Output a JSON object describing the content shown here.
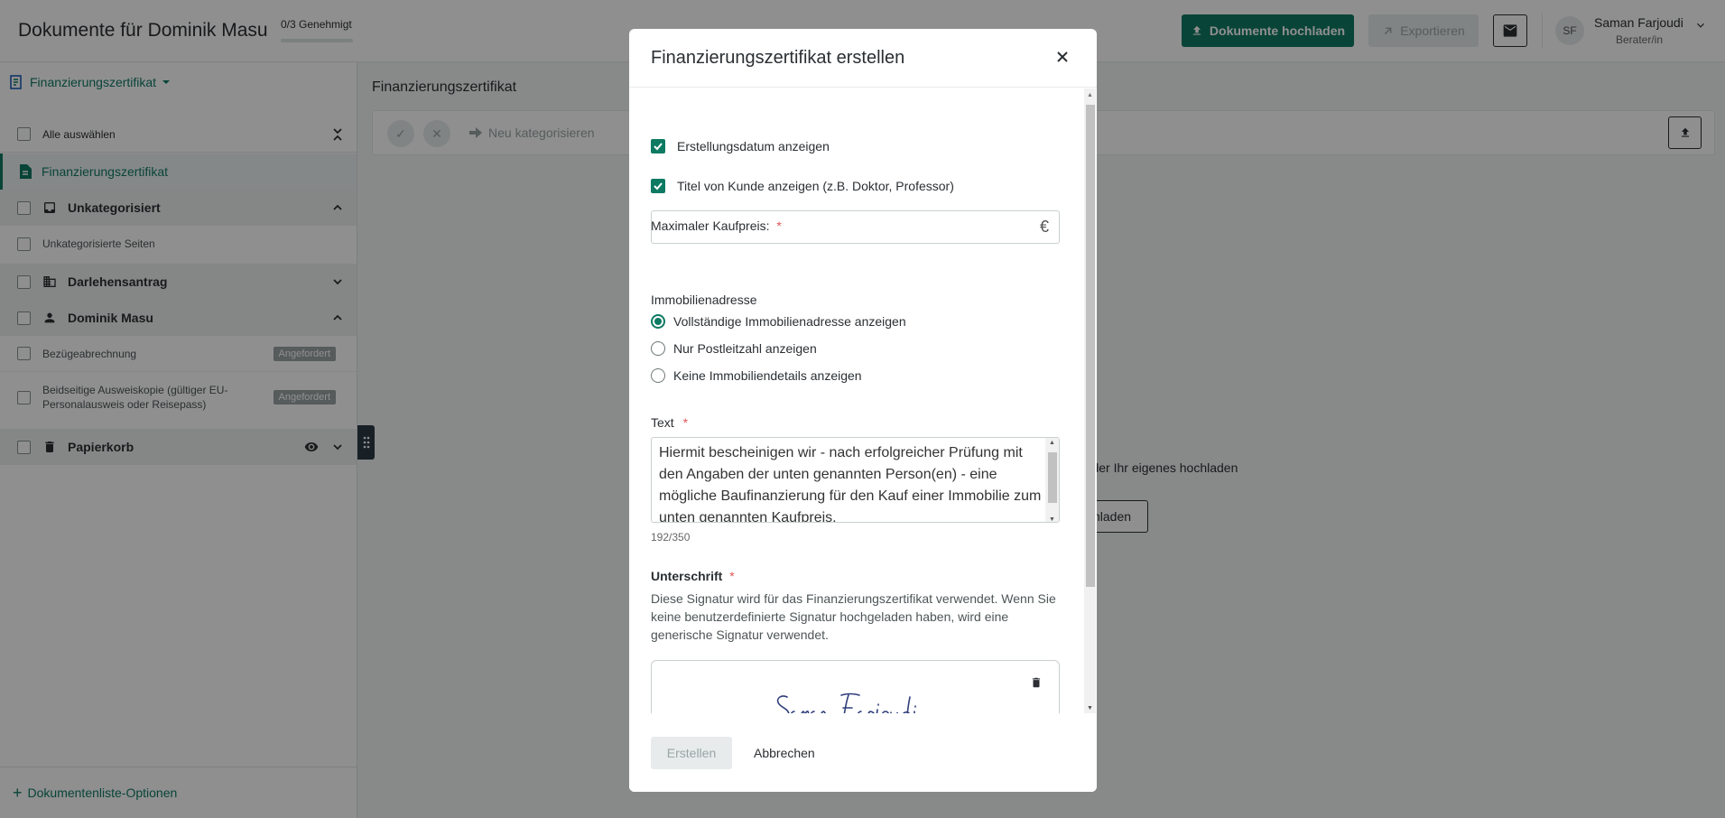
{
  "header": {
    "title": "Dokumente für Dominik Masu",
    "approval_status": "0/3 Genehmigt",
    "approval_progress": 0,
    "upload_button": "Dokumente hochladen",
    "export_button": "Exportieren",
    "mail_icon": "mail-icon",
    "user": {
      "initials": "SF",
      "name": "Saman Farjoudi",
      "role": "Berater/in"
    }
  },
  "sidebar": {
    "selector_label": "Finanzierungszertifikat",
    "select_all": "Alle auswählen",
    "active_item": "Finanzierungszertifikat",
    "categories": [
      {
        "label": "Unkategorisiert",
        "icon": "inbox-icon",
        "expanded": true,
        "pages": [
          {
            "label": "Unkategorisierte Seiten",
            "badge": ""
          }
        ]
      },
      {
        "label": "Darlehensantrag",
        "icon": "building-icon",
        "expanded": false,
        "pages": []
      },
      {
        "label": "Dominik Masu",
        "icon": "person-icon",
        "expanded": true,
        "pages": [
          {
            "label": "Bezügeabrechnung",
            "badge": "Angefordert"
          },
          {
            "label": "Beidseitige Ausweiskopie (gültiger EU-Personalausweis oder Reisepass)",
            "badge": "Angefordert"
          }
        ]
      },
      {
        "label": "Papierkorb",
        "icon": "trash-icon",
        "expanded": false,
        "pages": []
      }
    ],
    "bottom_link": "Dokumentenliste-Optionen"
  },
  "main": {
    "title": "Finanzierungszertifikat",
    "toolbar": {
      "recategorize": "Neu kategorisieren"
    },
    "empty_text": "n oder Ihr eigenes hochladen",
    "empty_button": "hladen"
  },
  "modal": {
    "title": "Finanzierungszertifikat erstellen",
    "checkbox_date": "Erstellungsdatum anzeigen",
    "checkbox_date_checked": true,
    "checkbox_title": "Titel von Kunde anzeigen (z.B. Doktor, Professor)",
    "checkbox_title_checked": true,
    "price_label": "Maximaler Kaufpreis:",
    "required_mark": "*",
    "price_value": "",
    "currency": "€",
    "address_label": "Immobilienadresse",
    "address_options": [
      {
        "label": "Vollständige Immobilienadresse anzeigen",
        "selected": true
      },
      {
        "label": "Nur Postleitzahl anzeigen",
        "selected": false
      },
      {
        "label": "Keine Immobiliendetails anzeigen",
        "selected": false
      }
    ],
    "text_label": "Text",
    "text_value": "Hiermit bescheinigen wir - nach erfolgreicher Prüfung mit den Angaben der unten genannten Person(en) - eine mögliche Baufinanzierung für den Kauf einer Immobilie zum unten genannten Kaufpreis.",
    "char_count": "192/350",
    "signature_label": "Unterschrift",
    "signature_description": "Diese Signatur wird für das Finanzierungszertifikat verwendet. Wenn Sie keine benutzerdefinierte Signatur hochgeladen haben, wird eine generische Signatur verwendet.",
    "signature_text": "Saman Farjoudi",
    "create_button": "Erstellen",
    "cancel_button": "Abbrechen"
  },
  "colors": {
    "accent": "#0f7a63",
    "required": "#e05656",
    "badge": "#9aa3a4"
  }
}
